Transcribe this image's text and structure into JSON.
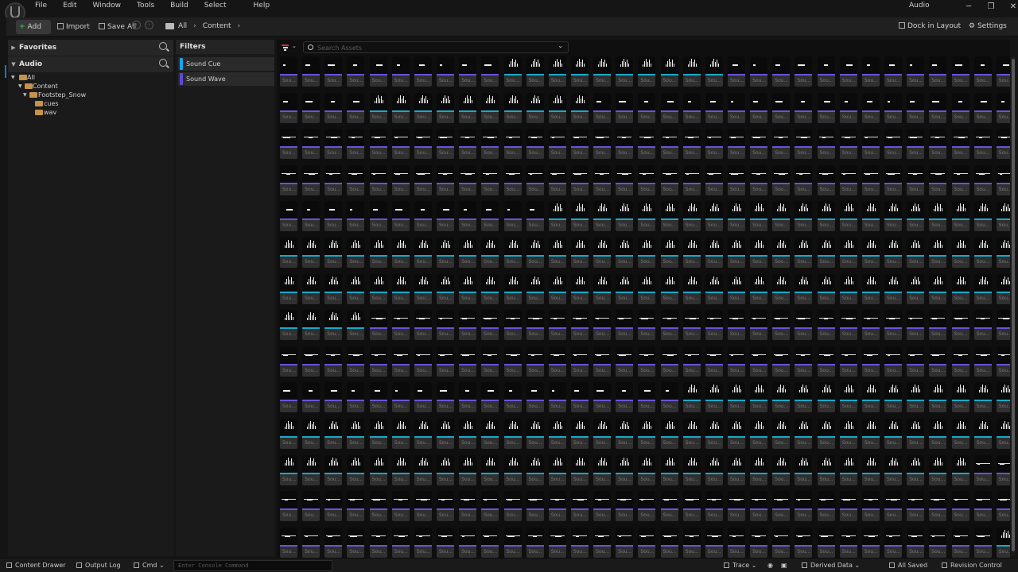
{
  "menu": {
    "items": [
      "File",
      "Edit",
      "Window",
      "Tools",
      "Build",
      "Select",
      "Help"
    ],
    "app_name": "Audio",
    "window_controls": [
      "─",
      "❐",
      "✕"
    ]
  },
  "toolbar": {
    "add_label": "Add",
    "import_label": "Import",
    "save_all_label": "Save All",
    "breadcrumb": [
      "All",
      "Content"
    ],
    "dock_label": "Dock in Layout",
    "settings_label": "Settings"
  },
  "sources": {
    "favorites_label": "Favorites",
    "audio_label": "Audio",
    "tree": [
      "All",
      "Content",
      "Footstep_Snow",
      "cues",
      "wav"
    ]
  },
  "filters": {
    "title": "Filters",
    "items": [
      {
        "label": "Sound Cue",
        "color": "#1aa3e8"
      },
      {
        "label": "Sound Wave",
        "color": "#5b4bd4"
      }
    ]
  },
  "assets": {
    "search_placeholder": "Search Assets",
    "tile_label": "Sou...",
    "cue_color": "#18a9c8",
    "wave_color": "#6a52d8",
    "rows": [
      "wwwwwwwwwwccccccccccwwwwwwwwwwwww",
      "wwwwccccccccccwwwwwwwwwwwwwwwwwww",
      "wwwwwwwwwwwwwwwwwwwwwwwwwwwwwwwww",
      "wwwwwwwwwwwwwwwwwwwwwwwwwwwwwwwww",
      "wwwwwwwwwwwwccccccccccccccccccccc",
      "ccccccccccccccccccccccccccccccccc",
      "ccccccccccccccccccccccccccccccccc",
      "ccccwwwwwwwwwwwwwwwwwwwwwwwwwwwww",
      "wwwwwwwwwwwwwwwwwwwwwwwwwwwwwwwww",
      "wwwwwwwwwwwwwwwwwwccccccccccccccc",
      "ccccccccccccccccccccccccccccccccc",
      "cccccccccccccccccccccccccccccccww",
      "wwwwwwwwwwwwwwwwwwwwwwwwwwwwwwwww",
      "wwwwwwwwwwwwwwwwwwwwwwwwwwwwwwwwc"
    ]
  },
  "status": {
    "content_drawer": "Content Drawer",
    "output_log": "Output Log",
    "cmd": "Cmd",
    "console_placeholder": "Enter Console Command",
    "trace": "Trace",
    "derived_data": "Derived Data",
    "all_saved": "All Saved",
    "revision_control": "Revision Control"
  }
}
